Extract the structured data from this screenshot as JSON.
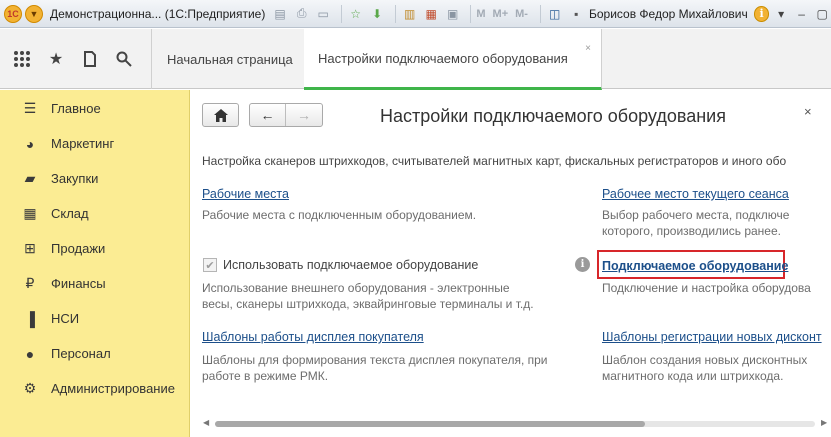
{
  "titlebar": {
    "app_icon": "1С",
    "title": "Демонстрационна... (1С:Предприятие)",
    "icons": [
      "save-icon",
      "print-icon",
      "preview-icon",
      "favorite-add-icon",
      "arrow-down-icon",
      "ledger-icon",
      "calendar-icon",
      "calculator-icon"
    ],
    "m_buttons": [
      "M",
      "M+",
      "M-"
    ],
    "user": "Борисов Федор Михайлович",
    "info": "i"
  },
  "toolbar": {
    "icons": [
      "apps-grid-icon",
      "star-icon",
      "history-icon",
      "search-icon"
    ]
  },
  "tabs": [
    {
      "label": "Начальная страница",
      "active": false
    },
    {
      "label": "Настройки подключаемого оборудования",
      "active": true,
      "close": "×"
    }
  ],
  "sidebar": {
    "items": [
      {
        "label": "Главное",
        "icon": "menu-lines-icon"
      },
      {
        "label": "Маркетинг",
        "icon": "pie-chart-icon"
      },
      {
        "label": "Закупки",
        "icon": "truck-icon"
      },
      {
        "label": "Склад",
        "icon": "warehouse-icon"
      },
      {
        "label": "Продажи",
        "icon": "basket-icon"
      },
      {
        "label": "Финансы",
        "icon": "ruble-icon"
      },
      {
        "label": "НСИ",
        "icon": "books-icon"
      },
      {
        "label": "Персонал",
        "icon": "person-icon"
      },
      {
        "label": "Администрирование",
        "icon": "gear-icon"
      }
    ]
  },
  "main": {
    "title": "Настройки подключаемого оборудования",
    "close": "×",
    "description": "Настройка сканеров штрихкодов, считывателей магнитных карт, фискальных регистраторов и иного обо",
    "left": {
      "workplaces_link": "Рабочие места",
      "workplaces_desc": "Рабочие места с подключенным оборудованием.",
      "use_equipment_label": "Использовать подключаемое оборудование",
      "use_equipment_checked": true,
      "use_equipment_desc_1": "Использование внешнего оборудования - электронные",
      "use_equipment_desc_2": "весы, сканеры штрихкода, эквайринговые терминалы и т.д.",
      "templates_link": "Шаблоны работы дисплея покупателя",
      "templates_desc_1": "Шаблоны для формирования текста дисплея покупателя, при",
      "templates_desc_2": "работе в режиме РМК."
    },
    "right": {
      "current_workplace_link": "Рабочее место текущего сеанса",
      "current_workplace_desc_1": "Выбор рабочего места, подключе",
      "current_workplace_desc_2": "которого, производились ранее.",
      "equipment_link": "Подключаемое оборудование",
      "equipment_desc": "Подключение и настройка оборудова",
      "discount_link": "Шаблоны регистрации новых дисконт",
      "discount_desc_1": "Шаблон создания новых дисконтных",
      "discount_desc_2": "магнитного кода или штрихкода."
    }
  },
  "colors": {
    "sidebar_bg": "#fbec93",
    "link": "#1c4f8a",
    "active_tab_underline": "#3fb54a",
    "highlight": "#d7262a"
  }
}
